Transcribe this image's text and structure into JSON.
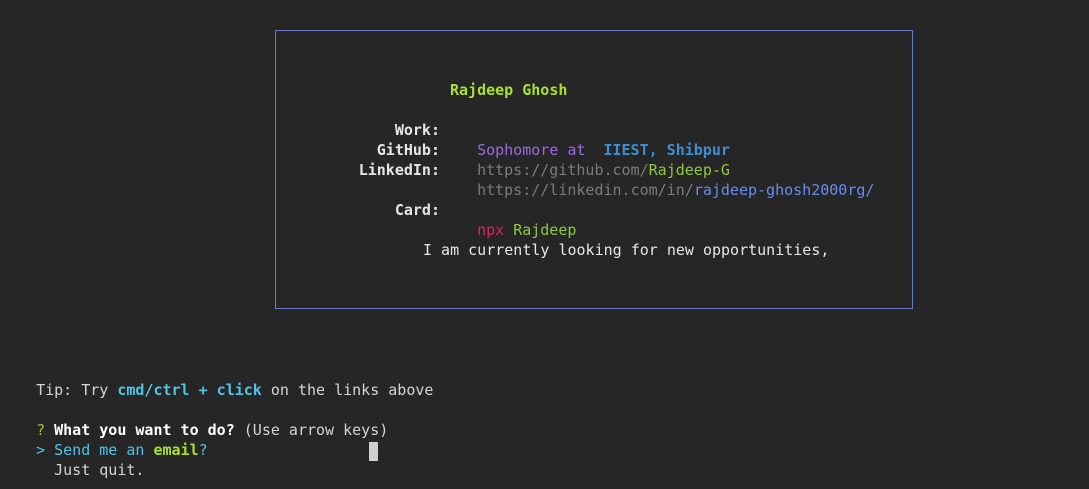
{
  "card": {
    "name": "Rajdeep Ghosh",
    "work": {
      "label": "Work:",
      "prefix": "Sophomore at ",
      "org": "IIEST, Shibpur"
    },
    "github": {
      "label": "GitHub:",
      "base": "https://github.com/",
      "handle": "Rajdeep-G"
    },
    "linkedin": {
      "label": "LinkedIn:",
      "base": "https://linkedin.com/in/",
      "handle": "rajdeep-ghosh2000rg/"
    },
    "card_cmd": {
      "label": "Card:",
      "npx": "npx",
      "pkg": "Rajdeep"
    },
    "message": "I am currently looking for new opportunities,"
  },
  "tip": {
    "prefix": "Tip: Try ",
    "keys": "cmd/ctrl + click",
    "suffix": " on the links above"
  },
  "prompt": {
    "mark": "?",
    "question": "What you want to do?",
    "hint": "(Use arrow keys)",
    "options": [
      {
        "pointer": ">",
        "prefix": "Send me an ",
        "keyword": "email",
        "suffix": "?"
      },
      {
        "pointer": " ",
        "prefix": "Just quit.",
        "keyword": "",
        "suffix": ""
      }
    ]
  },
  "colors": {
    "border": "#6a78c8",
    "name": "#a6e22e",
    "purple": "#9b6bdf",
    "blue": "#3d8fd1",
    "gray_link": "#7b7b7b",
    "green": "#8fc93a",
    "link_blue": "#6a8cf0",
    "npx_red": "#e0245e",
    "cyan": "#4fc3e8"
  }
}
